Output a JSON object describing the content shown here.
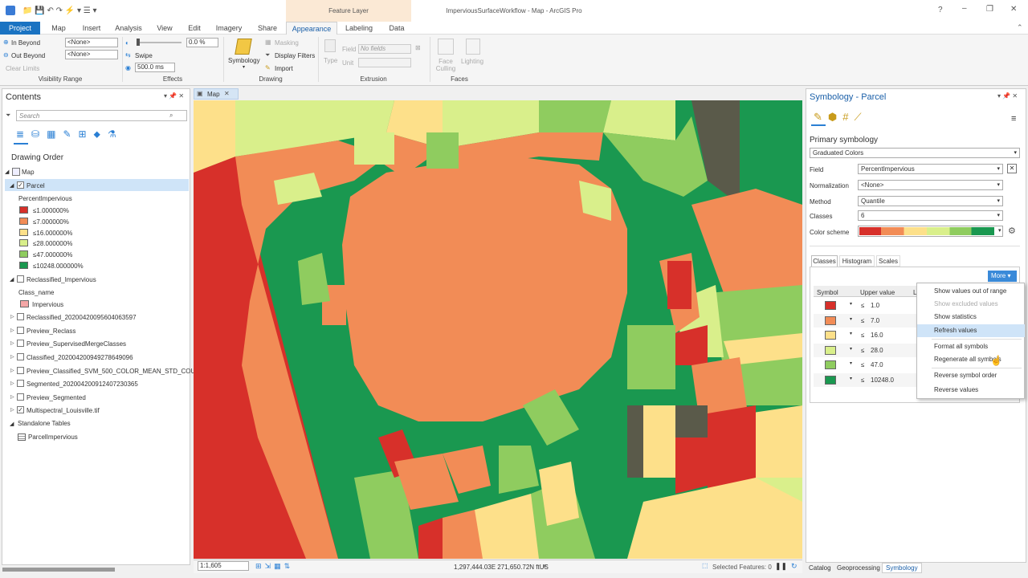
{
  "window": {
    "title": "ImperviousSurfaceWorkflow - Map - ArcGIS Pro",
    "context_tab": "Feature Layer"
  },
  "tabs": [
    "Project",
    "Map",
    "Insert",
    "Analysis",
    "View",
    "Edit",
    "Imagery",
    "Share",
    "Appearance",
    "Labeling",
    "Data"
  ],
  "ribbon": {
    "visibility": {
      "in_beyond": "In Beyond",
      "out_beyond": "Out Beyond",
      "clear_limits": "Clear Limits",
      "in_value": "<None>",
      "out_value": "<None>",
      "label": "Visibility Range"
    },
    "effects": {
      "transparency": "0.0 %",
      "swipe": "Swipe",
      "flicker": "500.0  ms",
      "label": "Effects"
    },
    "drawing": {
      "symbology": "Symbology",
      "masking": "Masking",
      "display_filters": "Display Filters",
      "import": "Import",
      "label": "Drawing"
    },
    "extrusion": {
      "type": "Type",
      "field": "Field",
      "field_value": "No fields",
      "unit": "Unit",
      "label": "Extrusion"
    },
    "faces": {
      "face_culling": "Face Culling",
      "lighting": "Lighting",
      "label": "Faces"
    }
  },
  "contents": {
    "title": "Contents",
    "search_placeholder": "Search",
    "drawing_order": "Drawing Order",
    "map": "Map",
    "parcel": {
      "name": "Parcel",
      "field": "PercentImpervious",
      "classes": [
        {
          "label": "≤1.000000%",
          "color": "#d7302a"
        },
        {
          "label": "≤7.000000%",
          "color": "#f28c56"
        },
        {
          "label": "≤16.000000%",
          "color": "#fde08a"
        },
        {
          "label": "≤28.000000%",
          "color": "#d9ef8b"
        },
        {
          "label": "≤47.000000%",
          "color": "#8fcc5f"
        },
        {
          "label": "≤10248.000000%",
          "color": "#1a9850"
        }
      ]
    },
    "reclassified": {
      "name": "Reclassified_Impervious",
      "field": "Class_name",
      "class": "Impervious",
      "color": "#f4a6a6"
    },
    "layers": [
      "Reclassified_20200420095604063597",
      "Preview_Reclass",
      "Preview_SupervisedMergeClasses",
      "Classified_20200420094927864909​6",
      "Preview_Classified_SVM_500_COLOR_MEAN_STD_COUNT",
      "Segmented_20200420091240723036​5",
      "Preview_Segmented",
      "Multispectral_Louisville.tif"
    ],
    "standalone": "Standalone Tables",
    "table": "ParcelImpervious"
  },
  "map": {
    "tab": "Map",
    "scale": "1:1,605",
    "coords": "1,297,444.03E 271,650.72N ftUS",
    "selected": "Selected Features: 0"
  },
  "symbology": {
    "title": "Symbology - Parcel",
    "primary": "Primary symbology",
    "method_type": "Graduated Colors",
    "field_label": "Field",
    "field": "PercentImpervious",
    "normalization_label": "Normalization",
    "normalization": "<None>",
    "method_label": "Method",
    "method": "Quantile",
    "classes_label": "Classes",
    "classes": "6",
    "scheme_label": "Color scheme",
    "subtabs": [
      "Classes",
      "Histogram",
      "Scales"
    ],
    "more": "More",
    "col_symbol": "Symbol",
    "col_upper": "Upper value",
    "col_label": "L",
    "rows": [
      {
        "op": "≤",
        "value": "1.0",
        "color": "#d7302a"
      },
      {
        "op": "≤",
        "value": "7.0",
        "color": "#f28c56"
      },
      {
        "op": "≤",
        "value": "16.0",
        "color": "#fde08a"
      },
      {
        "op": "≤",
        "value": "28.0",
        "color": "#d9ef8b"
      },
      {
        "op": "≤",
        "value": "47.0",
        "color": "#8fcc5f"
      },
      {
        "op": "≤",
        "value": "10248.0",
        "color": "#1a9850"
      }
    ],
    "menu": [
      {
        "label": "Show values out of range",
        "state": ""
      },
      {
        "label": "Show excluded values",
        "state": "dis"
      },
      {
        "label": "Show statistics",
        "state": ""
      },
      {
        "label": "Refresh values",
        "state": "hl"
      },
      {
        "label": "Format all symbols",
        "state": ""
      },
      {
        "label": "Regenerate all symbols",
        "state": ""
      },
      {
        "label": "Reverse symbol order",
        "state": ""
      },
      {
        "label": "Reverse values",
        "state": ""
      }
    ]
  },
  "bottom_tabs": [
    "Catalog",
    "Geoprocessing",
    "Symbology"
  ]
}
